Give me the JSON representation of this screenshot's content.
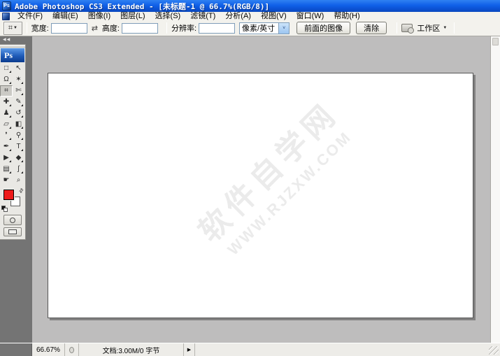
{
  "title_bar": {
    "app_icon": "Ps",
    "title": "Adobe Photoshop CS3 Extended - [未标题-1 @ 66.7%(RGB/8)]"
  },
  "menu_bar": {
    "items": [
      {
        "key": "file",
        "label": "文件(F)"
      },
      {
        "key": "edit",
        "label": "编辑(E)"
      },
      {
        "key": "image",
        "label": "图像(I)"
      },
      {
        "key": "layer",
        "label": "图层(L)"
      },
      {
        "key": "select",
        "label": "选择(S)"
      },
      {
        "key": "filter",
        "label": "滤镜(T)"
      },
      {
        "key": "analysis",
        "label": "分析(A)"
      },
      {
        "key": "view",
        "label": "视图(V)"
      },
      {
        "key": "window",
        "label": "窗口(W)"
      },
      {
        "key": "help",
        "label": "帮助(H)"
      }
    ]
  },
  "options_bar": {
    "active_tool_glyph": "⌗",
    "dropdown_caret": "▼",
    "width_label": "宽度:",
    "width_value": "",
    "swap_glyph": "⇄",
    "height_label": "高度:",
    "height_value": "",
    "resolution_label": "分辨率:",
    "resolution_value": "",
    "unit_value": "像素/英寸",
    "unit_caret": "˅",
    "front_image_button": "前面的图像",
    "clear_button": "清除",
    "workspace_label": "工作区",
    "workspace_caret": "▼"
  },
  "toolbox": {
    "collapse_glyph": "◀◀",
    "logo": "Ps",
    "foreground_color": "#EE1A1A",
    "background_color": "#FFFFFF",
    "swap_colors_glyph": "⇄",
    "tools": [
      {
        "name": "rectangular-marquee-tool",
        "glyph": "□",
        "selected": false,
        "flyout": true
      },
      {
        "name": "move-tool",
        "glyph": "↖",
        "selected": false,
        "flyout": false
      },
      {
        "name": "lasso-tool",
        "glyph": "Ω",
        "selected": false,
        "flyout": true
      },
      {
        "name": "magic-wand-tool",
        "glyph": "✶",
        "selected": false,
        "flyout": true
      },
      {
        "name": "crop-tool",
        "glyph": "⌗",
        "selected": true,
        "flyout": false
      },
      {
        "name": "slice-tool",
        "glyph": "✄",
        "selected": false,
        "flyout": true
      },
      {
        "name": "spot-healing-brush-tool",
        "glyph": "✚",
        "selected": false,
        "flyout": true
      },
      {
        "name": "brush-tool",
        "glyph": "✎",
        "selected": false,
        "flyout": true
      },
      {
        "name": "clone-stamp-tool",
        "glyph": "♟",
        "selected": false,
        "flyout": true
      },
      {
        "name": "history-brush-tool",
        "glyph": "↺",
        "selected": false,
        "flyout": true
      },
      {
        "name": "eraser-tool",
        "glyph": "▱",
        "selected": false,
        "flyout": true
      },
      {
        "name": "gradient-tool",
        "glyph": "◧",
        "selected": false,
        "flyout": true
      },
      {
        "name": "blur-tool",
        "glyph": "❜",
        "selected": false,
        "flyout": true
      },
      {
        "name": "dodge-tool",
        "glyph": "⚲",
        "selected": false,
        "flyout": true
      },
      {
        "name": "pen-tool",
        "glyph": "✒",
        "selected": false,
        "flyout": true
      },
      {
        "name": "type-tool",
        "glyph": "T",
        "selected": false,
        "flyout": true
      },
      {
        "name": "path-selection-tool",
        "glyph": "▶",
        "selected": false,
        "flyout": true
      },
      {
        "name": "custom-shape-tool",
        "glyph": "◆",
        "selected": false,
        "flyout": true
      },
      {
        "name": "notes-tool",
        "glyph": "▤",
        "selected": false,
        "flyout": true
      },
      {
        "name": "eyedropper-tool",
        "glyph": "ʃ",
        "selected": false,
        "flyout": true
      },
      {
        "name": "hand-tool",
        "glyph": "☛",
        "selected": false,
        "flyout": false
      },
      {
        "name": "zoom-tool",
        "glyph": "⌕",
        "selected": false,
        "flyout": false
      }
    ]
  },
  "canvas": {
    "watermark_line1": "软件自学网",
    "watermark_line2": "WWW.RJZXW.COM"
  },
  "status_bar": {
    "zoom": "66.67%",
    "doc_info": "文档:3.00M/0 字节",
    "expand_glyph": "▶"
  },
  "colors": {
    "titlebar_blue": "#1060E8",
    "workarea_gray": "#BEBDBD",
    "dock_gray": "#747474",
    "chrome_gray": "#F3F2ED",
    "foreground_red": "#EE1A1A"
  }
}
